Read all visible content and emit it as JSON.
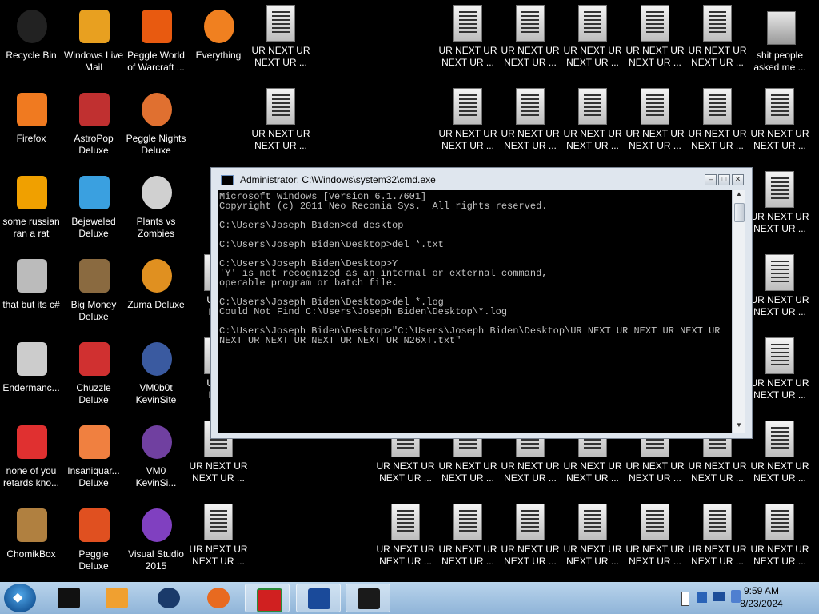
{
  "desktop": {
    "icons_left": [
      {
        "label": "Recycle Bin",
        "icon": "recycle-bin-icon"
      },
      {
        "label": "Windows Live Mail",
        "icon": "windows-live-mail-icon"
      },
      {
        "label": "Peggle World of Warcraft ...",
        "icon": "peggle-world-of-warcraft-icon"
      },
      {
        "label": "Everything",
        "icon": "everything-icon"
      },
      {
        "label": "Firefox",
        "icon": "firefox-icon"
      },
      {
        "label": "AstroPop Deluxe",
        "icon": "astropop-deluxe-icon"
      },
      {
        "label": "Peggle Nights Deluxe",
        "icon": "peggle-nights-deluxe-icon"
      },
      {
        "label": "some russian ran a rat",
        "icon": "some-russian-ran-a-rat-icon"
      },
      {
        "label": "Bejeweled Deluxe",
        "icon": "bejeweled-deluxe-icon"
      },
      {
        "label": "Plants vs Zombies",
        "icon": "plants-vs-zombies-icon"
      },
      {
        "label": "that but its c#",
        "icon": "that-but-its-csharp-icon"
      },
      {
        "label": "Big Money Deluxe",
        "icon": "big-money-deluxe-icon"
      },
      {
        "label": "Zuma Deluxe",
        "icon": "zuma-deluxe-icon"
      },
      {
        "label": "Endermanc...",
        "icon": "endermanc-icon"
      },
      {
        "label": "Chuzzle Deluxe",
        "icon": "chuzzle-deluxe-icon"
      },
      {
        "label": "VM0b0t KevinSite",
        "icon": "vm0b0t-kevinsite-icon"
      },
      {
        "label": "none of you retards kno...",
        "icon": "none-of-you-icon"
      },
      {
        "label": "Insaniquar... Deluxe",
        "icon": "insaniquarium-deluxe-icon"
      },
      {
        "label": "VM0 KevinSi...",
        "icon": "vm0-kevinsite-icon"
      },
      {
        "label": "ChomikBox",
        "icon": "chomikbox-icon"
      },
      {
        "label": "Peggle Deluxe",
        "icon": "peggle-deluxe-icon"
      },
      {
        "label": "Visual Studio 2015",
        "icon": "visual-studio-2015-icon"
      }
    ],
    "urnext_label_line1": "UR NEXT UR",
    "urnext_label_line2": "NEXT UR ...",
    "urnext_partial": "UR N",
    "urnext_partial2": "NEX",
    "shit_people_label": "shit people asked me ..."
  },
  "cmd": {
    "title": "Administrator: C:\\Windows\\system32\\cmd.exe",
    "minimize": "–",
    "maximize": "□",
    "close": "✕",
    "lines": [
      "Microsoft Windows [Version 6.1.7601]",
      "Copyright (c) 2011 Neo Reconia Sys.  All rights reserved.",
      "",
      "C:\\Users\\Joseph Biden>cd desktop",
      "",
      "C:\\Users\\Joseph Biden\\Desktop>del *.txt",
      "",
      "C:\\Users\\Joseph Biden\\Desktop>Y",
      "'Y' is not recognized as an internal or external command,",
      "operable program or batch file.",
      "",
      "C:\\Users\\Joseph Biden\\Desktop>del *.log",
      "Could Not Find C:\\Users\\Joseph Biden\\Desktop\\*.log",
      "",
      "C:\\Users\\Joseph Biden\\Desktop>\"C:\\Users\\Joseph Biden\\Desktop\\UR NEXT UR NEXT UR NEXT UR NEXT UR NEXT UR NEXT UR NEXT UR N26XT.txt\""
    ]
  },
  "taskbar": {
    "items": [
      "terminal-app-icon",
      "media-player-icon",
      "world-globe-icon",
      "firefox-taskbar-icon",
      "avira-icon",
      "malwarebytes-icon",
      "cmd-taskbar-icon"
    ],
    "clock_time": "9:59 AM",
    "clock_date": "8/23/2024"
  }
}
